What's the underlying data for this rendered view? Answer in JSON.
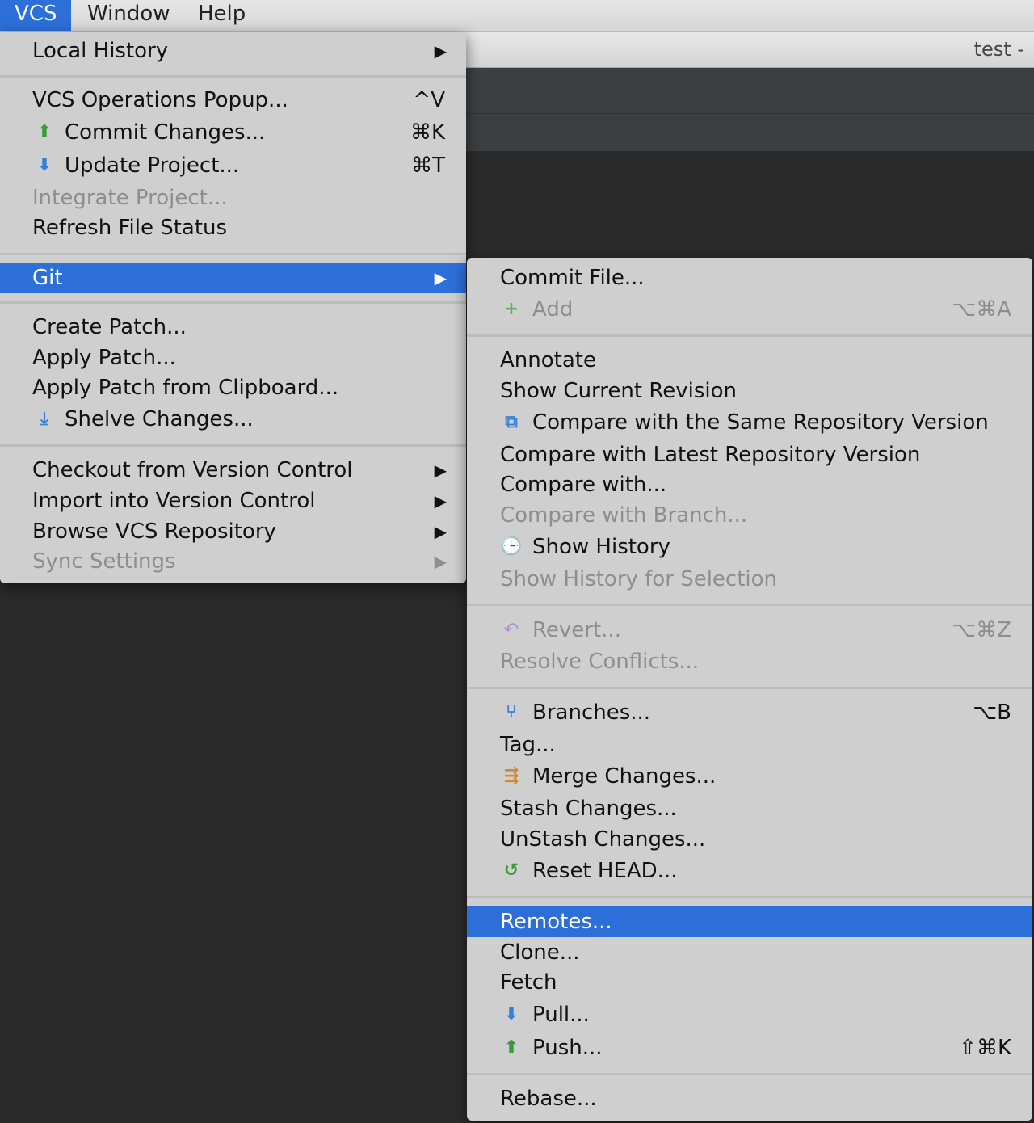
{
  "menubar": {
    "vcs": "VCS",
    "window": "Window",
    "help": "Help"
  },
  "ide": {
    "title": "test -"
  },
  "vcs_menu": {
    "local_history": "Local History",
    "vcs_operations_popup": "VCS Operations Popup...",
    "vcs_operations_popup_shortcut": "^V",
    "commit_changes": "Commit Changes...",
    "commit_changes_shortcut": "⌘K",
    "update_project": "Update Project...",
    "update_project_shortcut": "⌘T",
    "integrate_project": "Integrate Project...",
    "refresh_file_status": "Refresh File Status",
    "git": "Git",
    "create_patch": "Create Patch...",
    "apply_patch": "Apply Patch...",
    "apply_patch_clipboard": "Apply Patch from Clipboard...",
    "shelve_changes": "Shelve Changes...",
    "checkout": "Checkout from Version Control",
    "import": "Import into Version Control",
    "browse": "Browse VCS Repository",
    "sync_settings": "Sync Settings",
    "submenu_arrow": "▶"
  },
  "git_menu": {
    "commit_file": "Commit File...",
    "add": "Add",
    "add_shortcut": "⌥⌘A",
    "annotate": "Annotate",
    "show_current_revision": "Show Current Revision",
    "compare_same": "Compare with the Same Repository Version",
    "compare_latest": "Compare with Latest Repository Version",
    "compare_with": "Compare with...",
    "compare_branch": "Compare with Branch...",
    "show_history": "Show History",
    "show_history_selection": "Show History for Selection",
    "revert": "Revert...",
    "revert_shortcut": "⌥⌘Z",
    "resolve_conflicts": "Resolve Conflicts...",
    "branches": "Branches...",
    "branches_shortcut": "⌥B",
    "tag": "Tag...",
    "merge_changes": "Merge Changes...",
    "stash_changes": "Stash Changes...",
    "unstash_changes": "UnStash Changes...",
    "reset_head": "Reset HEAD...",
    "remotes": "Remotes...",
    "clone": "Clone...",
    "fetch": "Fetch",
    "pull": "Pull...",
    "push": "Push...",
    "push_shortcut": "⇧⌘K",
    "rebase": "Rebase..."
  },
  "colors": {
    "selection": "#2d6fd9",
    "menu_bg": "#cfcfcf",
    "ide_bg": "#2b2b2b"
  },
  "icons": {
    "commit": "commit-arrow-up-icon",
    "update": "update-arrow-down-icon",
    "shelve": "shelve-icon",
    "add": "plus-icon",
    "compare": "compare-icon",
    "history": "history-icon",
    "revert": "revert-icon",
    "branches": "branches-icon",
    "merge": "merge-icon",
    "reset": "reset-icon",
    "pull": "pull-icon",
    "push": "push-icon"
  }
}
